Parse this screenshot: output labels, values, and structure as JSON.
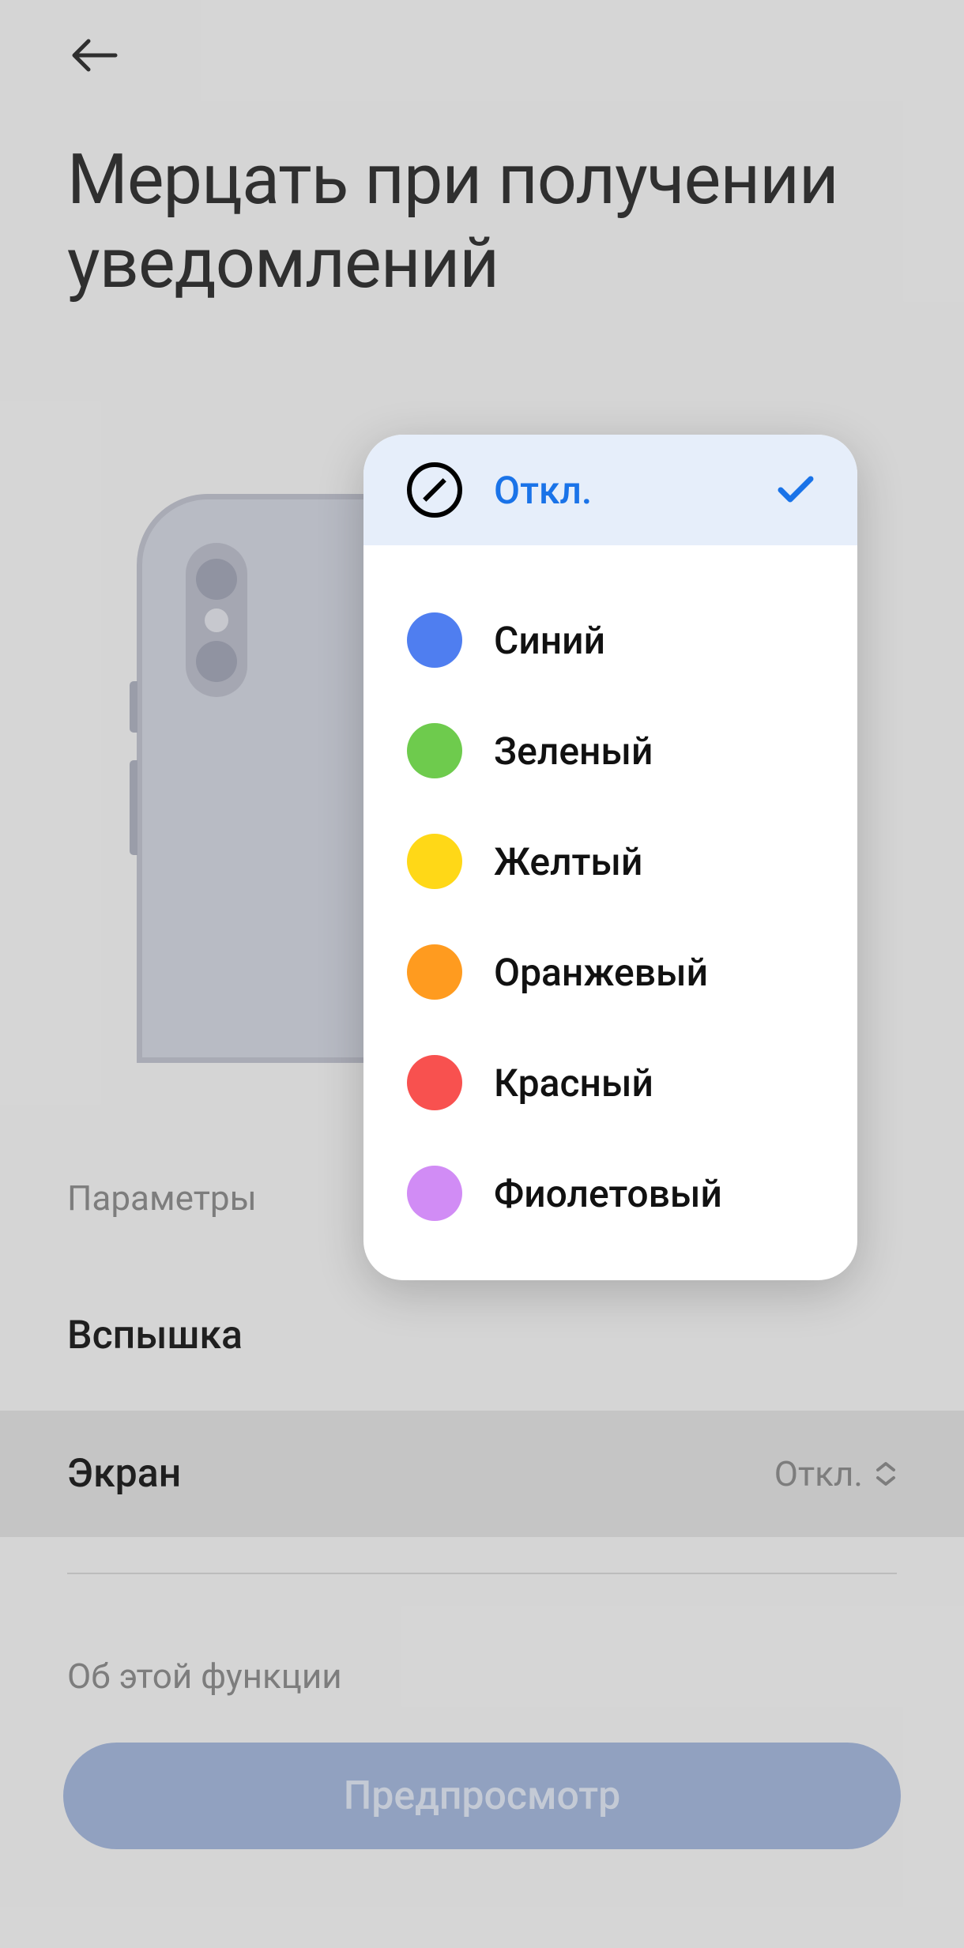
{
  "header": {
    "title": "Мерцать при получении уведомлений"
  },
  "sections": {
    "params_label": "Параметры",
    "about_label": "Об этой функции"
  },
  "settings": {
    "flash": {
      "title": "Вспышка"
    },
    "screen": {
      "title": "Экран",
      "value": "Откл."
    }
  },
  "preview_button_label": "Предпросмотр",
  "popup": {
    "options": [
      {
        "label": "Откл.",
        "type": "off",
        "selected": true
      },
      {
        "label": "Синий",
        "type": "color",
        "color": "#4f7ef0"
      },
      {
        "label": "Зеленый",
        "type": "color",
        "color": "#6ecb4d"
      },
      {
        "label": "Желтый",
        "type": "color",
        "color": "#ffd817"
      },
      {
        "label": "Оранжевый",
        "type": "color",
        "color": "#ff9b1f"
      },
      {
        "label": "Красный",
        "type": "color",
        "color": "#f8514f"
      },
      {
        "label": "Фиолетовый",
        "type": "color",
        "color": "#d18cf5"
      }
    ]
  }
}
